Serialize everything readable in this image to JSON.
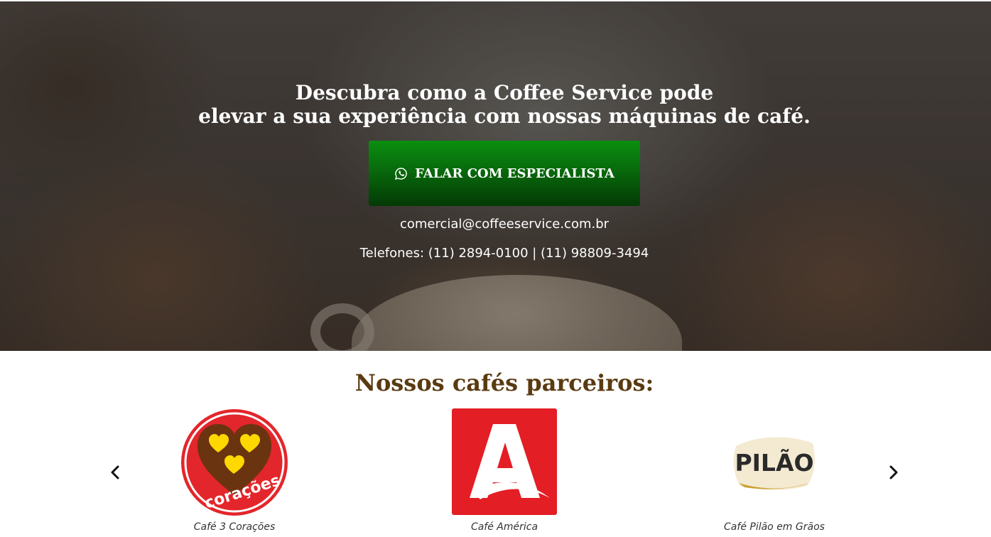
{
  "hero": {
    "title_line1": "Descubra como a Coffee Service pode",
    "title_line2": "elevar a sua experiência com nossas máquinas de café.",
    "cta_label": "FALAR COM ESPECIALISTA",
    "cta_icon": "whatsapp-icon",
    "email": "comercial@coffeeservice.com.br",
    "phones": "Telefones: (11) 2894-0100 | (11) 98809-3494"
  },
  "partners": {
    "title": "Nossos cafés parceiros:",
    "items": [
      {
        "name": "Café 3 Corações",
        "logo_text": "3 corações"
      },
      {
        "name": "Café América",
        "logo_text": "A"
      },
      {
        "name": "Café Pilão em Grãos",
        "logo_text": "PILÃO"
      }
    ],
    "prev_icon": "chevron-left-icon",
    "next_icon": "chevron-right-icon"
  },
  "colors": {
    "cta_green_top": "#0a8f10",
    "cta_green_bottom": "#033a05",
    "partners_title": "#5a3a10",
    "america_red": "#e31e24",
    "tres_coracoes_red": "#e3262b"
  }
}
